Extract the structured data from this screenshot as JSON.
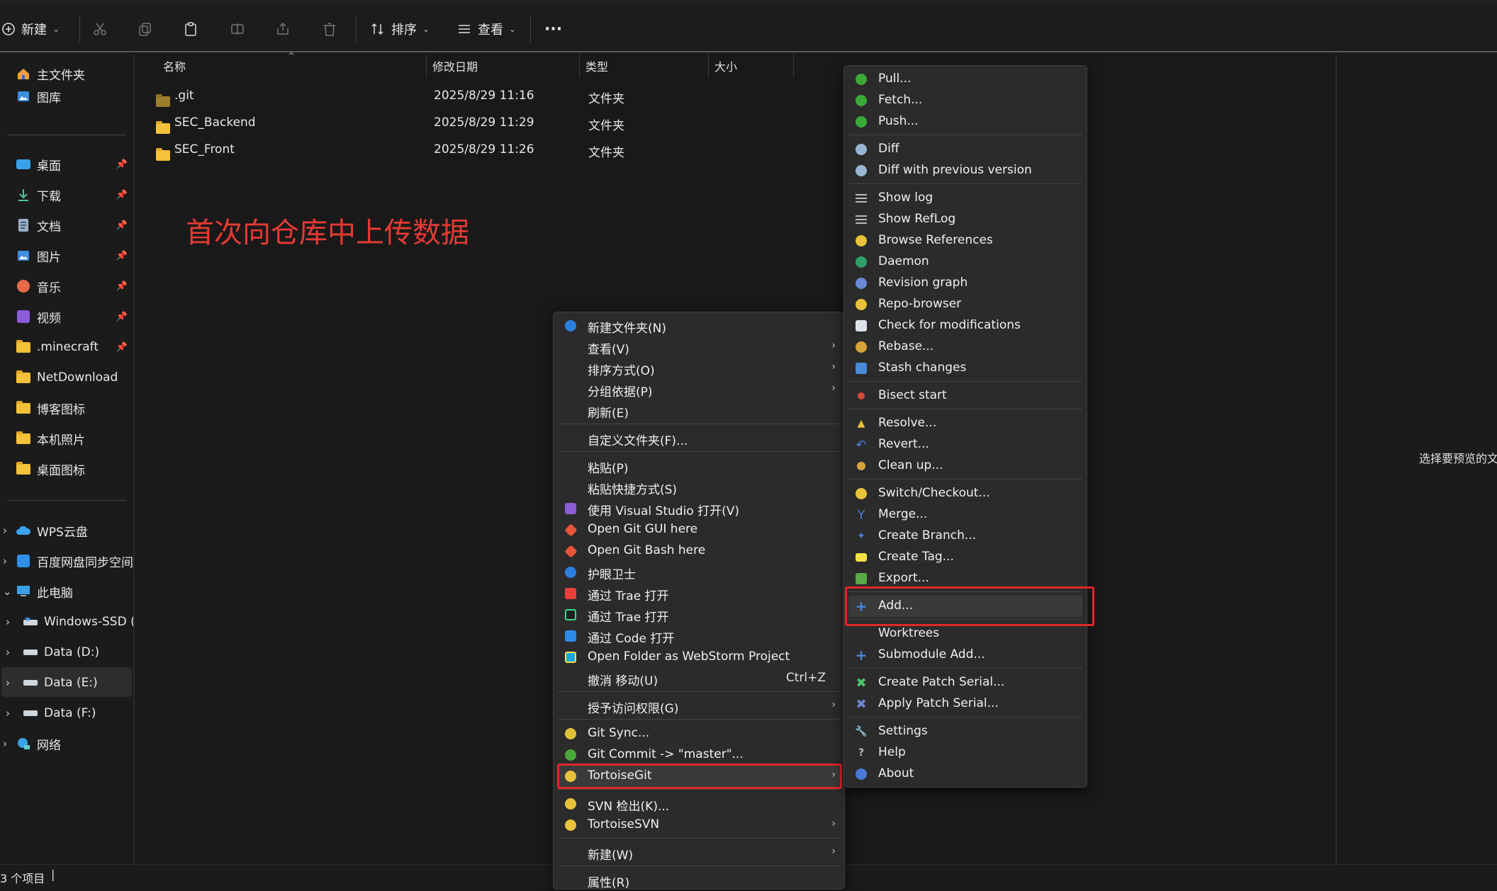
{
  "toolbar": {
    "new_label": "新建",
    "sort_label": "排序",
    "view_label": "查看",
    "more_label": "···"
  },
  "sidebar": {
    "top": [
      {
        "label": "主文件夹",
        "icon": "home-icon"
      },
      {
        "label": "图库",
        "icon": "gallery-icon"
      }
    ],
    "pinned": [
      {
        "label": "桌面",
        "icon": "desktop-icon"
      },
      {
        "label": "下载",
        "icon": "download-icon"
      },
      {
        "label": "文档",
        "icon": "document-icon"
      },
      {
        "label": "图片",
        "icon": "pictures-icon"
      },
      {
        "label": "音乐",
        "icon": "music-icon"
      },
      {
        "label": "视频",
        "icon": "video-icon"
      },
      {
        "label": ".minecraft",
        "icon": "folder-icon"
      },
      {
        "label": "NetDownload",
        "icon": "folder-icon"
      },
      {
        "label": "博客图标",
        "icon": "folder-icon"
      },
      {
        "label": "本机照片",
        "icon": "folder-icon"
      },
      {
        "label": "桌面图标",
        "icon": "folder-icon"
      }
    ],
    "locations": [
      {
        "label": "WPS云盘",
        "icon": "cloud-icon"
      },
      {
        "label": "百度网盘同步空间",
        "icon": "baidu-icon"
      },
      {
        "label": "此电脑",
        "icon": "computer-icon"
      },
      {
        "label": "Windows-SSD (C",
        "icon": "drive-icon"
      },
      {
        "label": "Data (D:)",
        "icon": "drive-icon"
      },
      {
        "label": "Data (E:)",
        "icon": "drive-icon"
      },
      {
        "label": "Data (F:)",
        "icon": "drive-icon"
      },
      {
        "label": "网络",
        "icon": "network-icon"
      }
    ]
  },
  "columns": {
    "name": "名称",
    "modified": "修改日期",
    "type": "类型",
    "size": "大小"
  },
  "files": [
    {
      "name": ".git",
      "modified": "2025/8/29 11:16",
      "type": "文件夹"
    },
    {
      "name": "SEC_Backend",
      "modified": "2025/8/29 11:29",
      "type": "文件夹"
    },
    {
      "name": "SEC_Front",
      "modified": "2025/8/29 11:26",
      "type": "文件夹"
    }
  ],
  "annotation": "首次向仓库中上传数据",
  "preview_text": "选择要预览的文",
  "status": "3 个项目",
  "context_menu": {
    "items": [
      {
        "label": "新建文件夹(N)"
      },
      {
        "label": "查看(V)"
      },
      {
        "label": "排序方式(O)"
      },
      {
        "label": "分组依据(P)"
      },
      {
        "label": "刷新(E)"
      },
      {
        "label": "自定义文件夹(F)..."
      },
      {
        "label": "粘贴(P)"
      },
      {
        "label": "粘贴快捷方式(S)"
      },
      {
        "label": "使用 Visual Studio 打开(V)"
      },
      {
        "label": "Open Git GUI here"
      },
      {
        "label": "Open Git Bash here"
      },
      {
        "label": "护眼卫士"
      },
      {
        "label": "通过 Trae 打开"
      },
      {
        "label": "通过 Trae 打开"
      },
      {
        "label": "通过 Code 打开"
      },
      {
        "label": "Open Folder as WebStorm Project"
      },
      {
        "label": "撤消 移动(U)",
        "shortcut": "Ctrl+Z"
      },
      {
        "label": "授予访问权限(G)"
      },
      {
        "label": "Git Sync..."
      },
      {
        "label": "Git Commit -> \"master\"..."
      },
      {
        "label": "TortoiseGit"
      },
      {
        "label": "SVN 检出(K)..."
      },
      {
        "label": "TortoiseSVN"
      },
      {
        "label": "新建(W)"
      },
      {
        "label": "属性(R)"
      }
    ]
  },
  "tortoise_menu": {
    "items": [
      {
        "label": "Pull..."
      },
      {
        "label": "Fetch..."
      },
      {
        "label": "Push..."
      },
      {
        "label": "Diff"
      },
      {
        "label": "Diff with previous version"
      },
      {
        "label": "Show log"
      },
      {
        "label": "Show RefLog"
      },
      {
        "label": "Browse References"
      },
      {
        "label": "Daemon"
      },
      {
        "label": "Revision graph"
      },
      {
        "label": "Repo-browser"
      },
      {
        "label": "Check for modifications"
      },
      {
        "label": "Rebase..."
      },
      {
        "label": "Stash changes"
      },
      {
        "label": "Bisect start"
      },
      {
        "label": "Resolve..."
      },
      {
        "label": "Revert..."
      },
      {
        "label": "Clean up..."
      },
      {
        "label": "Switch/Checkout..."
      },
      {
        "label": "Merge..."
      },
      {
        "label": "Create Branch..."
      },
      {
        "label": "Create Tag..."
      },
      {
        "label": "Export..."
      },
      {
        "label": "Add..."
      },
      {
        "label": "Worktrees"
      },
      {
        "label": "Submodule Add..."
      },
      {
        "label": "Create Patch Serial..."
      },
      {
        "label": "Apply Patch Serial..."
      },
      {
        "label": "Settings"
      },
      {
        "label": "Help"
      },
      {
        "label": "About"
      }
    ]
  },
  "colors": {
    "accent_red": "#e2262a",
    "folder_yellow": "#f4c13a",
    "background": "#191919"
  }
}
